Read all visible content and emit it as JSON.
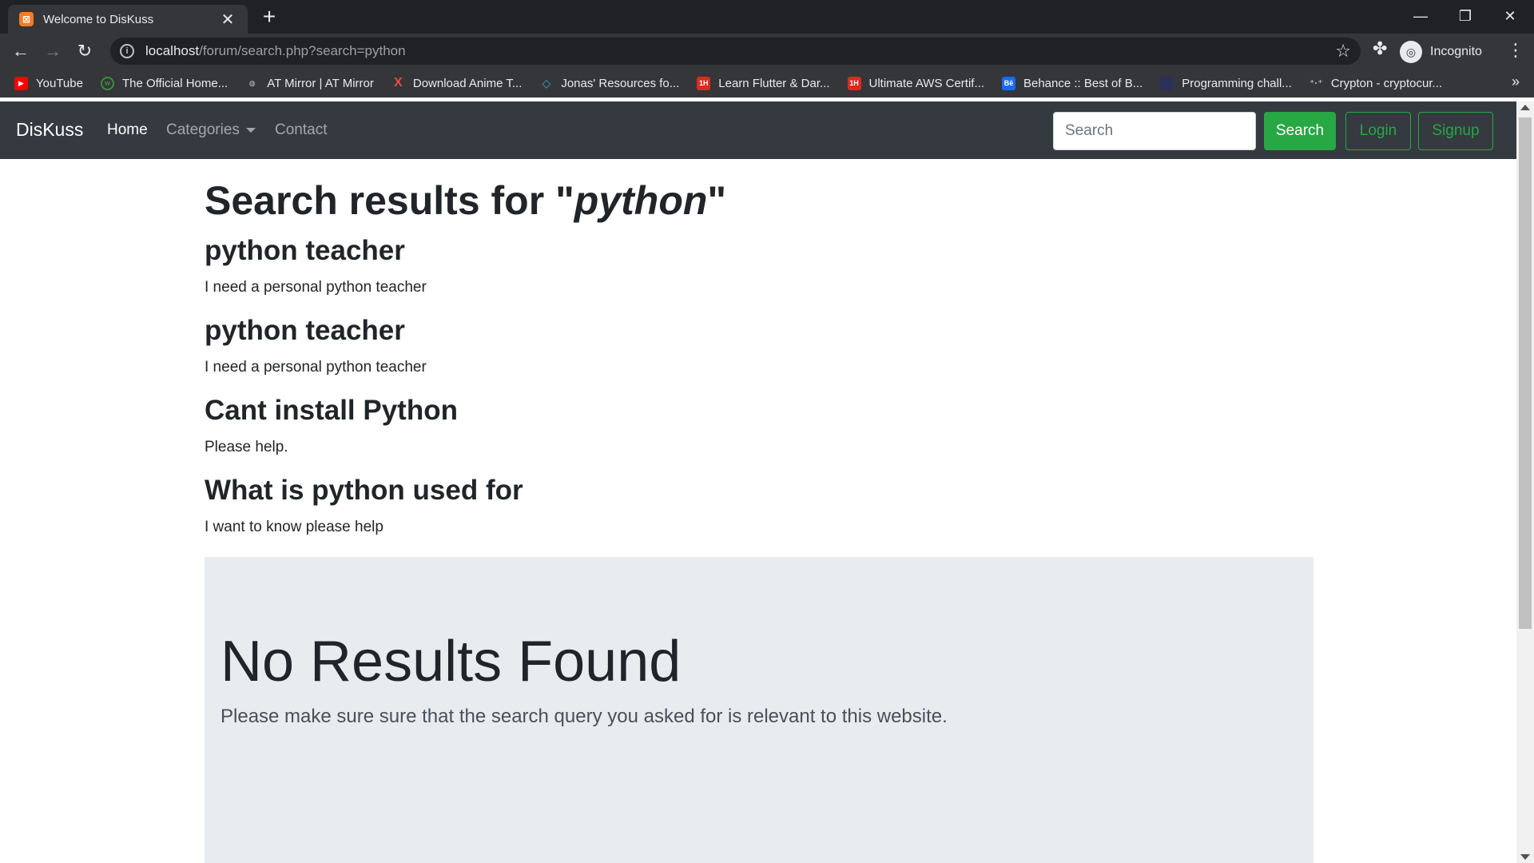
{
  "browser": {
    "tab_title": "Welcome to DisKuss",
    "tab_favicon": "xampp-icon",
    "url_host": "localhost",
    "url_path": "/forum/search.php?search=python",
    "profile_label": "Incognito",
    "bookmarks": [
      {
        "label": "YouTube",
        "icon": "youtube-icon",
        "color": "#ff0000"
      },
      {
        "label": "The Official Home...",
        "icon": "globe-icon",
        "color": "#3d8b3d"
      },
      {
        "label": "AT Mirror | AT Mirror",
        "icon": "mirror-icon",
        "color": "#555555"
      },
      {
        "label": "Download Anime T...",
        "icon": "x-icon",
        "color": "#e94b3c"
      },
      {
        "label": "Jonas' Resources fo...",
        "icon": "diamond-icon",
        "color": "#3fa7d6"
      },
      {
        "label": "Learn Flutter & Dar...",
        "icon": "1h-icon",
        "color": "#e0281e"
      },
      {
        "label": "Ultimate AWS Certif...",
        "icon": "1h-icon",
        "color": "#e0281e"
      },
      {
        "label": "Behance :: Best of B...",
        "icon": "behance-icon",
        "color": "#1769ff"
      },
      {
        "label": "Programming chall...",
        "icon": "square-icon",
        "color": "#2b2f59"
      },
      {
        "label": "Crypton - cryptocur...",
        "icon": "crypto-icon",
        "color": "#888888"
      }
    ]
  },
  "navbar": {
    "brand": "DisKuss",
    "links": [
      {
        "label": "Home"
      },
      {
        "label": "Categories"
      },
      {
        "label": "Contact"
      }
    ],
    "search_placeholder": "Search",
    "search_button": "Search",
    "login_button": "Login",
    "signup_button": "Signup"
  },
  "results": {
    "heading_prefix": "Search results for \"",
    "query": "python",
    "heading_suffix": "\"",
    "items": [
      {
        "title": "python teacher",
        "description": "I need a personal python teacher"
      },
      {
        "title": "python teacher",
        "description": "I need a personal python teacher"
      },
      {
        "title": "Cant install Python",
        "description": "Please help."
      },
      {
        "title": "What is python used for",
        "description": "I want to know please help"
      }
    ]
  },
  "no_results": {
    "title": "No Results Found",
    "lead": "Please make sure sure that the search query you asked for is relevant to this website."
  },
  "colors": {
    "navbar_bg": "#343a40",
    "success": "#28a745",
    "jumbotron_bg": "#e9ecef"
  }
}
